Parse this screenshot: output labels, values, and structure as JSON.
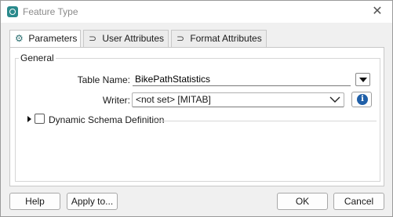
{
  "window": {
    "title": "Feature Type",
    "close_glyph": "✕",
    "app_icon": "fme-app-icon"
  },
  "tabs": [
    {
      "label": "Parameters",
      "icon": "gear-icon",
      "active": true
    },
    {
      "label": "User Attributes",
      "icon": "attribute-arrow-icon",
      "active": false
    },
    {
      "label": "Format Attributes",
      "icon": "attribute-arrow-icon",
      "active": false
    }
  ],
  "general": {
    "title": "General",
    "table_name": {
      "label": "Table Name:",
      "value": "BikePathStatistics"
    },
    "writer": {
      "label": "Writer:",
      "selected": "<not set> [MITAB]"
    },
    "dynamic_schema": {
      "label": "Dynamic Schema Definition",
      "checked": false,
      "expanded": false
    }
  },
  "footer": {
    "help_label": "Help",
    "apply_label": "Apply to...",
    "ok_label": "OK",
    "cancel_label": "Cancel"
  },
  "colors": {
    "accent": "#2a8a8c",
    "info": "#1f5fa8",
    "background": "#f0f0f0"
  }
}
